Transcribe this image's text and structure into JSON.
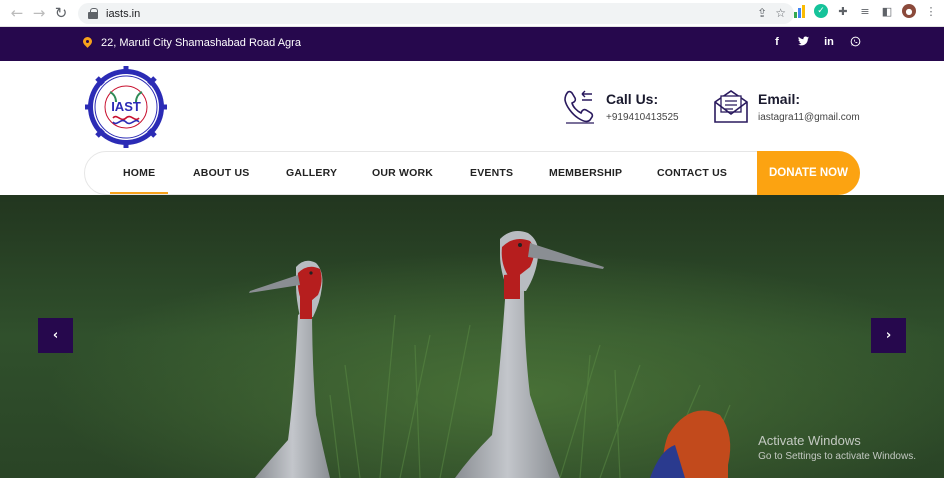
{
  "browser": {
    "url": "iasts.in",
    "back": "←",
    "forward": "→",
    "reload": "↻"
  },
  "topbar": {
    "address": "22, Maruti City Shamashabad Road Agra",
    "socials": [
      "f",
      "t",
      "in",
      "w"
    ],
    "bg_color": "#26084d",
    "accent": "#f7a21b"
  },
  "header": {
    "logo_text": "IAST",
    "call": {
      "title": "Call Us:",
      "value": "+919410413525"
    },
    "email": {
      "title": "Email:",
      "value": "iastagra11@gmail.com"
    }
  },
  "nav": {
    "items": [
      "HOME",
      "ABOUT US",
      "GALLERY",
      "OUR WORK",
      "EVENTS",
      "MEMBERSHIP",
      "CONTACT US"
    ],
    "active": "HOME",
    "donate": "DONATE NOW",
    "donate_color": "#fca311"
  },
  "hero": {
    "prev": "‹",
    "next": "›"
  },
  "watermark": {
    "title": "Activate Windows",
    "subtitle": "Go to Settings to activate Windows."
  }
}
